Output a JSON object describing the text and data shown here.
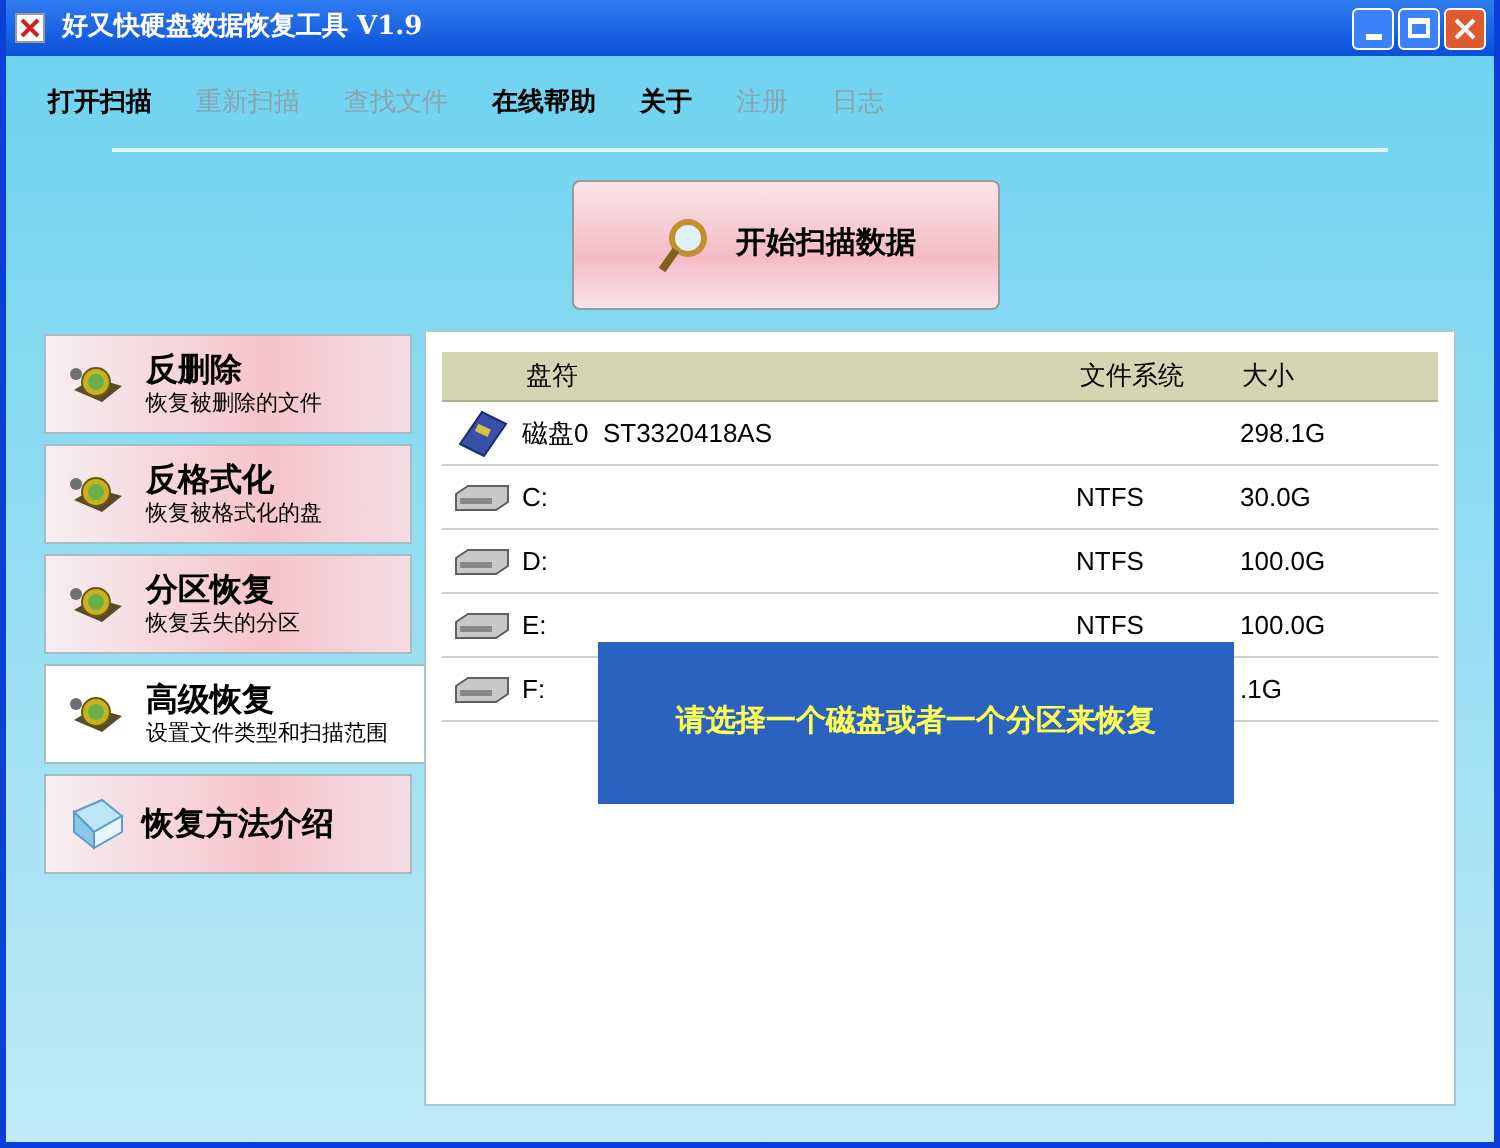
{
  "window": {
    "title": "好又快硬盘数据恢复工具 V1.9"
  },
  "menu": [
    {
      "label": "打开扫描",
      "disabled": false
    },
    {
      "label": "重新扫描",
      "disabled": true
    },
    {
      "label": "查找文件",
      "disabled": true
    },
    {
      "label": "在线帮助",
      "disabled": false
    },
    {
      "label": "关于",
      "disabled": false
    },
    {
      "label": "注册",
      "disabled": true
    },
    {
      "label": "日志",
      "disabled": true
    }
  ],
  "start_button": {
    "label": "开始扫描数据"
  },
  "sidebar": {
    "items": [
      {
        "title": "反删除",
        "subtitle": "恢复被删除的文件",
        "selected": false
      },
      {
        "title": "反格式化",
        "subtitle": "恢复被格式化的盘",
        "selected": false
      },
      {
        "title": "分区恢复",
        "subtitle": "恢复丢失的分区",
        "selected": false
      },
      {
        "title": "高级恢复",
        "subtitle": "设置文件类型和扫描范围",
        "selected": true
      },
      {
        "title": "恢复方法介绍",
        "selected": false
      }
    ]
  },
  "table": {
    "columns": [
      "盘符",
      "文件系统",
      "大小"
    ],
    "rows": [
      {
        "kind": "disk",
        "name": "磁盘0  ST3320418AS",
        "size": "298.1G"
      },
      {
        "kind": "partition",
        "name": "C:",
        "fs": "NTFS",
        "size": "30.0G"
      },
      {
        "kind": "partition",
        "name": "D:",
        "fs": "NTFS",
        "size": "100.0G"
      },
      {
        "kind": "partition",
        "name": "E:",
        "fs": "NTFS",
        "size": "100.0G"
      },
      {
        "kind": "partition",
        "name": "F:",
        "size": ".1G"
      }
    ]
  },
  "message": "请选择一个磁盘或者一个分区来恢复"
}
